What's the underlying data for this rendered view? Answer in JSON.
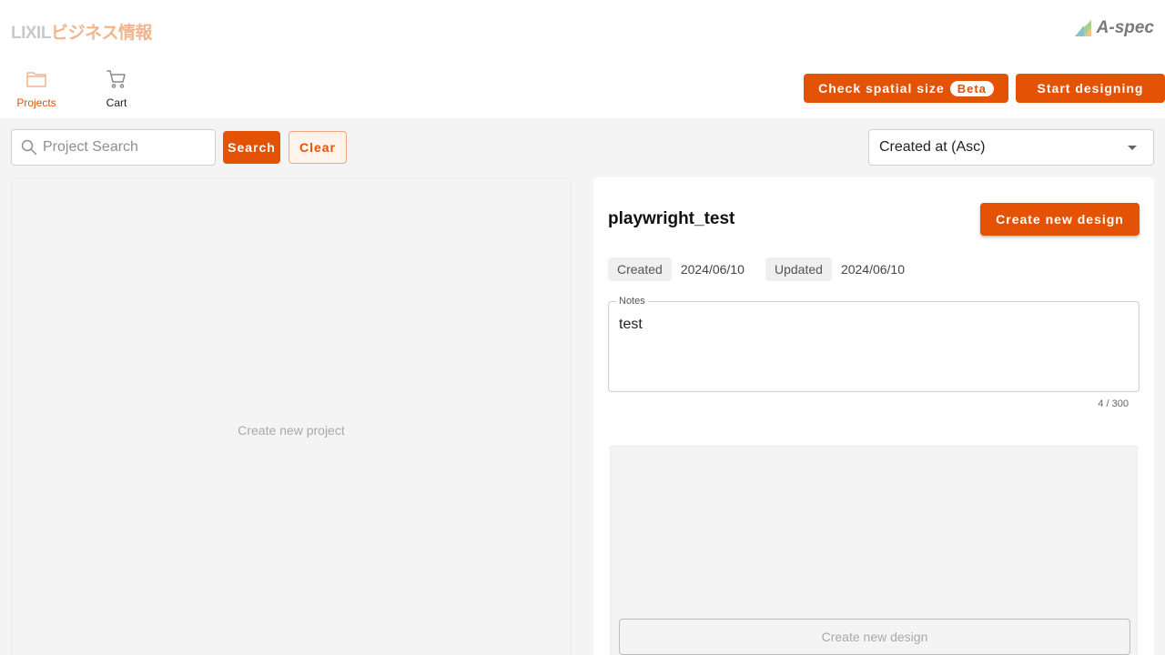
{
  "header": {
    "brand_part1": "LIXIL",
    "brand_part2": "ビジネス情報",
    "product_logo_text": "A-spec"
  },
  "nav": {
    "projects_label": "Projects",
    "cart_label": "Cart"
  },
  "actions": {
    "check_spatial_label": "Check spatial size",
    "beta_badge": "Beta",
    "start_designing_label": "Start designing"
  },
  "search": {
    "placeholder": "Project Search",
    "value": "",
    "search_label": "Search",
    "clear_label": "Clear"
  },
  "sort": {
    "selected": "Created at (Asc)"
  },
  "project_list": {
    "empty_text": "Create new project"
  },
  "project": {
    "title": "playwright_test",
    "create_design_label": "Create new design",
    "created_label": "Created",
    "created_value": "2024/06/10",
    "updated_label": "Updated",
    "updated_value": "2024/06/10",
    "notes_label": "Notes",
    "notes_value": "test",
    "notes_counter": "4 / 300",
    "create_design_outline_label": "Create new design"
  },
  "colors": {
    "accent": "#e35205",
    "background": "#f4f4f4"
  }
}
